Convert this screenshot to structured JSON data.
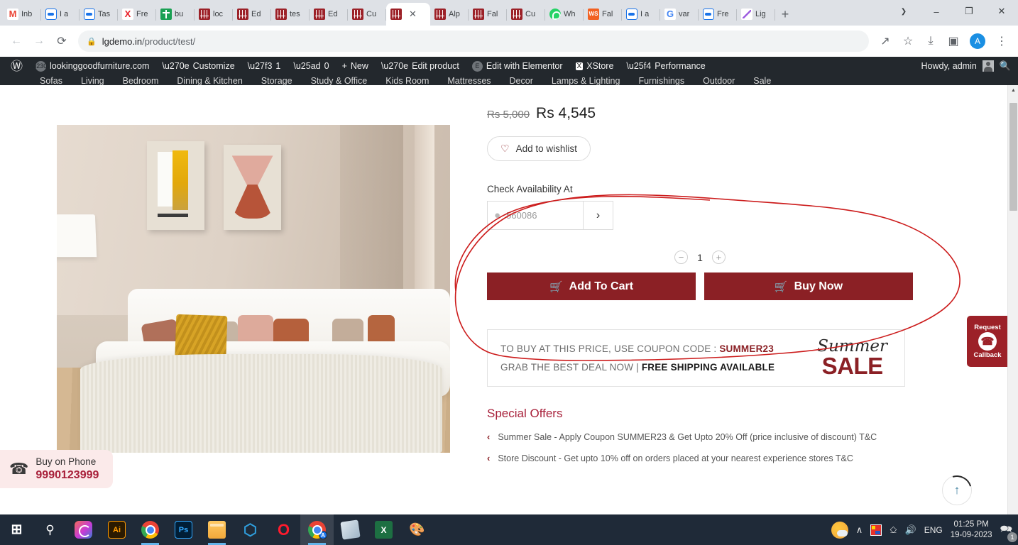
{
  "browser": {
    "tabs": [
      {
        "title": "Inb",
        "icon": "gmail-icon",
        "active": false
      },
      {
        "title": "I a",
        "icon": "blue-pill-icon",
        "active": false
      },
      {
        "title": "Tas",
        "icon": "blue-pill-icon",
        "active": false
      },
      {
        "title": "Fre",
        "icon": "x-red-icon",
        "active": false
      },
      {
        "title": "bu",
        "icon": "green-plus-icon",
        "active": false
      },
      {
        "title": "loc",
        "icon": "furniture-icon",
        "active": false
      },
      {
        "title": "Ed",
        "icon": "furniture-icon",
        "active": false
      },
      {
        "title": "tes",
        "icon": "furniture-icon",
        "active": false
      },
      {
        "title": "Ed",
        "icon": "furniture-icon",
        "active": false
      },
      {
        "title": "Cu",
        "icon": "furniture-icon",
        "active": false
      },
      {
        "title": "",
        "icon": "furniture-icon",
        "active": true
      },
      {
        "title": "Alp",
        "icon": "furniture-icon",
        "active": false
      },
      {
        "title": "Fal",
        "icon": "furniture-icon",
        "active": false
      },
      {
        "title": "Cu",
        "icon": "furniture-icon",
        "active": false
      },
      {
        "title": "Wh",
        "icon": "whatsapp-icon",
        "active": false
      },
      {
        "title": "Fal",
        "icon": "ws-orange-icon",
        "active": false
      },
      {
        "title": "I a",
        "icon": "blue-pill-icon",
        "active": false
      },
      {
        "title": "var",
        "icon": "google-icon",
        "active": false
      },
      {
        "title": "Fre",
        "icon": "blue-pill-icon",
        "active": false
      },
      {
        "title": "Lig",
        "icon": "feather-pen-icon",
        "active": false
      }
    ],
    "new_tab_label": "+",
    "window_controls": {
      "minimize": "–",
      "maximize": "❐",
      "close": "✕",
      "chevron": "❯"
    },
    "nav": {
      "back": "←",
      "forward": "→",
      "reload": "⟳"
    },
    "address": {
      "lock": "🔒",
      "host": "lgdemo.in",
      "path": "/product/test/"
    },
    "toolbar_right": {
      "share": "↗",
      "bookmark": "☆",
      "download": "⤓",
      "sidepanel": "▣",
      "profile": "A",
      "menu": "⋮"
    }
  },
  "wp_admin_bar": {
    "logo": "Ⓦ",
    "site_name": "lookinggoodfurniture.com",
    "customize": "Customize",
    "updates_count": "1",
    "comments_count": "0",
    "new": "New",
    "edit_product": "Edit product",
    "edit_elementor": "Edit with Elementor",
    "xstore": "XStore",
    "performance": "Performance",
    "howdy": "Howdy, admin",
    "search_icon": "🔍"
  },
  "site_nav": [
    "Sofas",
    "Living",
    "Bedroom",
    "Dining & Kitchen",
    "Storage",
    "Study & Office",
    "Kids Room",
    "Mattresses",
    "Decor",
    "Lamps & Lighting",
    "Furnishings",
    "Outdoor",
    "Sale"
  ],
  "product": {
    "price_old": "Rs 5,000",
    "price_new": "Rs 4,545",
    "wishlist_label": "Add to wishlist",
    "availability": {
      "label": "Check Availability At",
      "pincode_placeholder": "560086",
      "pincode_value": "",
      "submit_icon": "›"
    },
    "quantity": {
      "minus": "−",
      "value": "1",
      "plus": "+"
    },
    "add_to_cart": "Add To Cart",
    "buy_now": "Buy Now",
    "cart_icon": "🛒"
  },
  "coupon_banner": {
    "line1_pre": "TO BUY AT THIS PRICE, USE COUPON CODE : ",
    "line1_code": "SUMMER23",
    "line2_pre": "GRAB THE BEST DEAL NOW | ",
    "line2_bold": "FREE SHIPPING AVAILABLE",
    "badge_top": "Summer",
    "badge_bottom": "SALE"
  },
  "special_offers": {
    "title": "Special Offers",
    "items": [
      "Summer Sale - Apply Coupon SUMMER23 & Get Upto 20% Off (price inclusive of discount) T&C",
      "Store Discount - Get upto 10% off on orders placed at your nearest experience stores T&C"
    ],
    "arrow": "‹"
  },
  "floating": {
    "buy_on_phone_label": "Buy on Phone",
    "buy_on_phone_number": "9990123999",
    "phone_icon": "☎",
    "callback_top": "Request",
    "callback_bottom": "Callback",
    "callback_icon": "✆",
    "scroll_top_icon": "↑"
  },
  "taskbar": {
    "items": [
      {
        "name": "start-button",
        "glyph": "⊞",
        "cls": "ic-start",
        "active": false,
        "running": false
      },
      {
        "name": "search-button",
        "glyph": "⚲",
        "cls": "ic-search",
        "active": false,
        "running": false
      },
      {
        "name": "creative-cloud-icon",
        "glyph": "",
        "cls": "ic-cc",
        "active": false,
        "running": false
      },
      {
        "name": "illustrator-icon",
        "glyph": "Ai",
        "cls": "ic-ai",
        "active": false,
        "running": false
      },
      {
        "name": "chrome-icon",
        "glyph": "",
        "cls": "ic-chrome",
        "active": false,
        "running": true
      },
      {
        "name": "photoshop-icon",
        "glyph": "Ps",
        "cls": "ic-ps",
        "active": false,
        "running": false
      },
      {
        "name": "file-explorer-icon",
        "glyph": "",
        "cls": "ic-fold",
        "active": false,
        "running": true
      },
      {
        "name": "vscode-icon",
        "glyph": "⬡",
        "cls": "ic-vs",
        "active": false,
        "running": false
      },
      {
        "name": "opera-icon",
        "glyph": "O",
        "cls": "ic-op",
        "active": false,
        "running": false
      },
      {
        "name": "chrome-profile-icon",
        "glyph": "",
        "cls": "ic-chrome",
        "active": true,
        "running": true
      },
      {
        "name": "sticky-notes-icon",
        "glyph": "",
        "cls": "ic-note",
        "active": false,
        "running": false
      },
      {
        "name": "excel-icon",
        "glyph": "X",
        "cls": "ic-xl",
        "active": false,
        "running": false
      },
      {
        "name": "paint-icon",
        "glyph": "🎨",
        "cls": "ic-paint",
        "active": false,
        "running": false
      }
    ],
    "tray": {
      "chevron": "∧",
      "network_icon": "⎐",
      "volume_icon": "🔊",
      "language": "ENG",
      "time": "01:25 PM",
      "date": "19-09-2023",
      "notification_icon": "🗪",
      "notification_count": "1"
    }
  },
  "colors": {
    "brand_red": "#8b2025",
    "accent_pink": "#a8203a",
    "annotation_red": "#cc1c1c",
    "taskbar": "#1f2a38",
    "wp_bar": "#23282d"
  }
}
